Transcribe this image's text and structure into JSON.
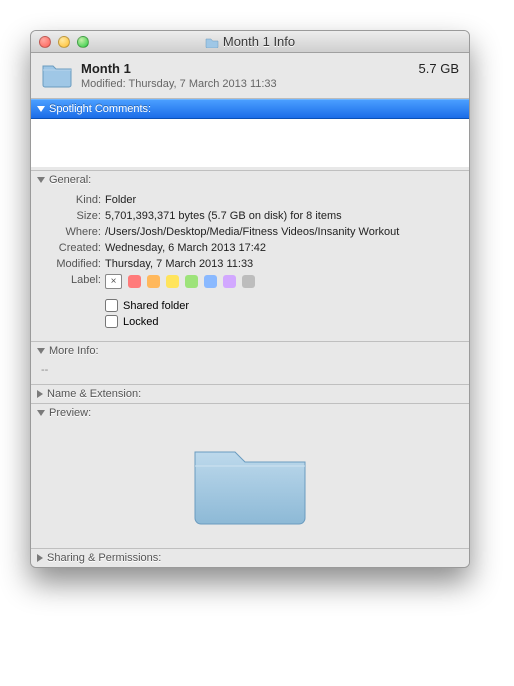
{
  "window": {
    "title": "Month 1 Info"
  },
  "header": {
    "name": "Month 1",
    "modified_label": "Modified: Thursday, 7 March 2013 11:33",
    "size": "5.7 GB"
  },
  "sections": {
    "spotlight": {
      "title": "Spotlight Comments:",
      "value": ""
    },
    "general": {
      "title": "General:",
      "kind_label": "Kind:",
      "kind": "Folder",
      "size_label": "Size:",
      "size": "5,701,393,371 bytes (5.7 GB on disk) for 8 items",
      "where_label": "Where:",
      "where": "/Users/Josh/Desktop/Media/Fitness Videos/Insanity Workout",
      "created_label": "Created:",
      "created": "Wednesday, 6 March 2013 17:42",
      "modified_label": "Modified:",
      "modified": "Thursday, 7 March 2013 11:33",
      "label_label": "Label:",
      "shared_label": "Shared folder",
      "locked_label": "Locked"
    },
    "moreinfo": {
      "title": "More Info:",
      "value": "--"
    },
    "nameext": {
      "title": "Name & Extension:"
    },
    "preview": {
      "title": "Preview:"
    },
    "sharing": {
      "title": "Sharing & Permissions:"
    }
  },
  "label_colors": [
    "#ff7a7a",
    "#ffb85c",
    "#ffe45c",
    "#9de37a",
    "#8ab9ff",
    "#d2a8ff",
    "#bdbdbd"
  ]
}
